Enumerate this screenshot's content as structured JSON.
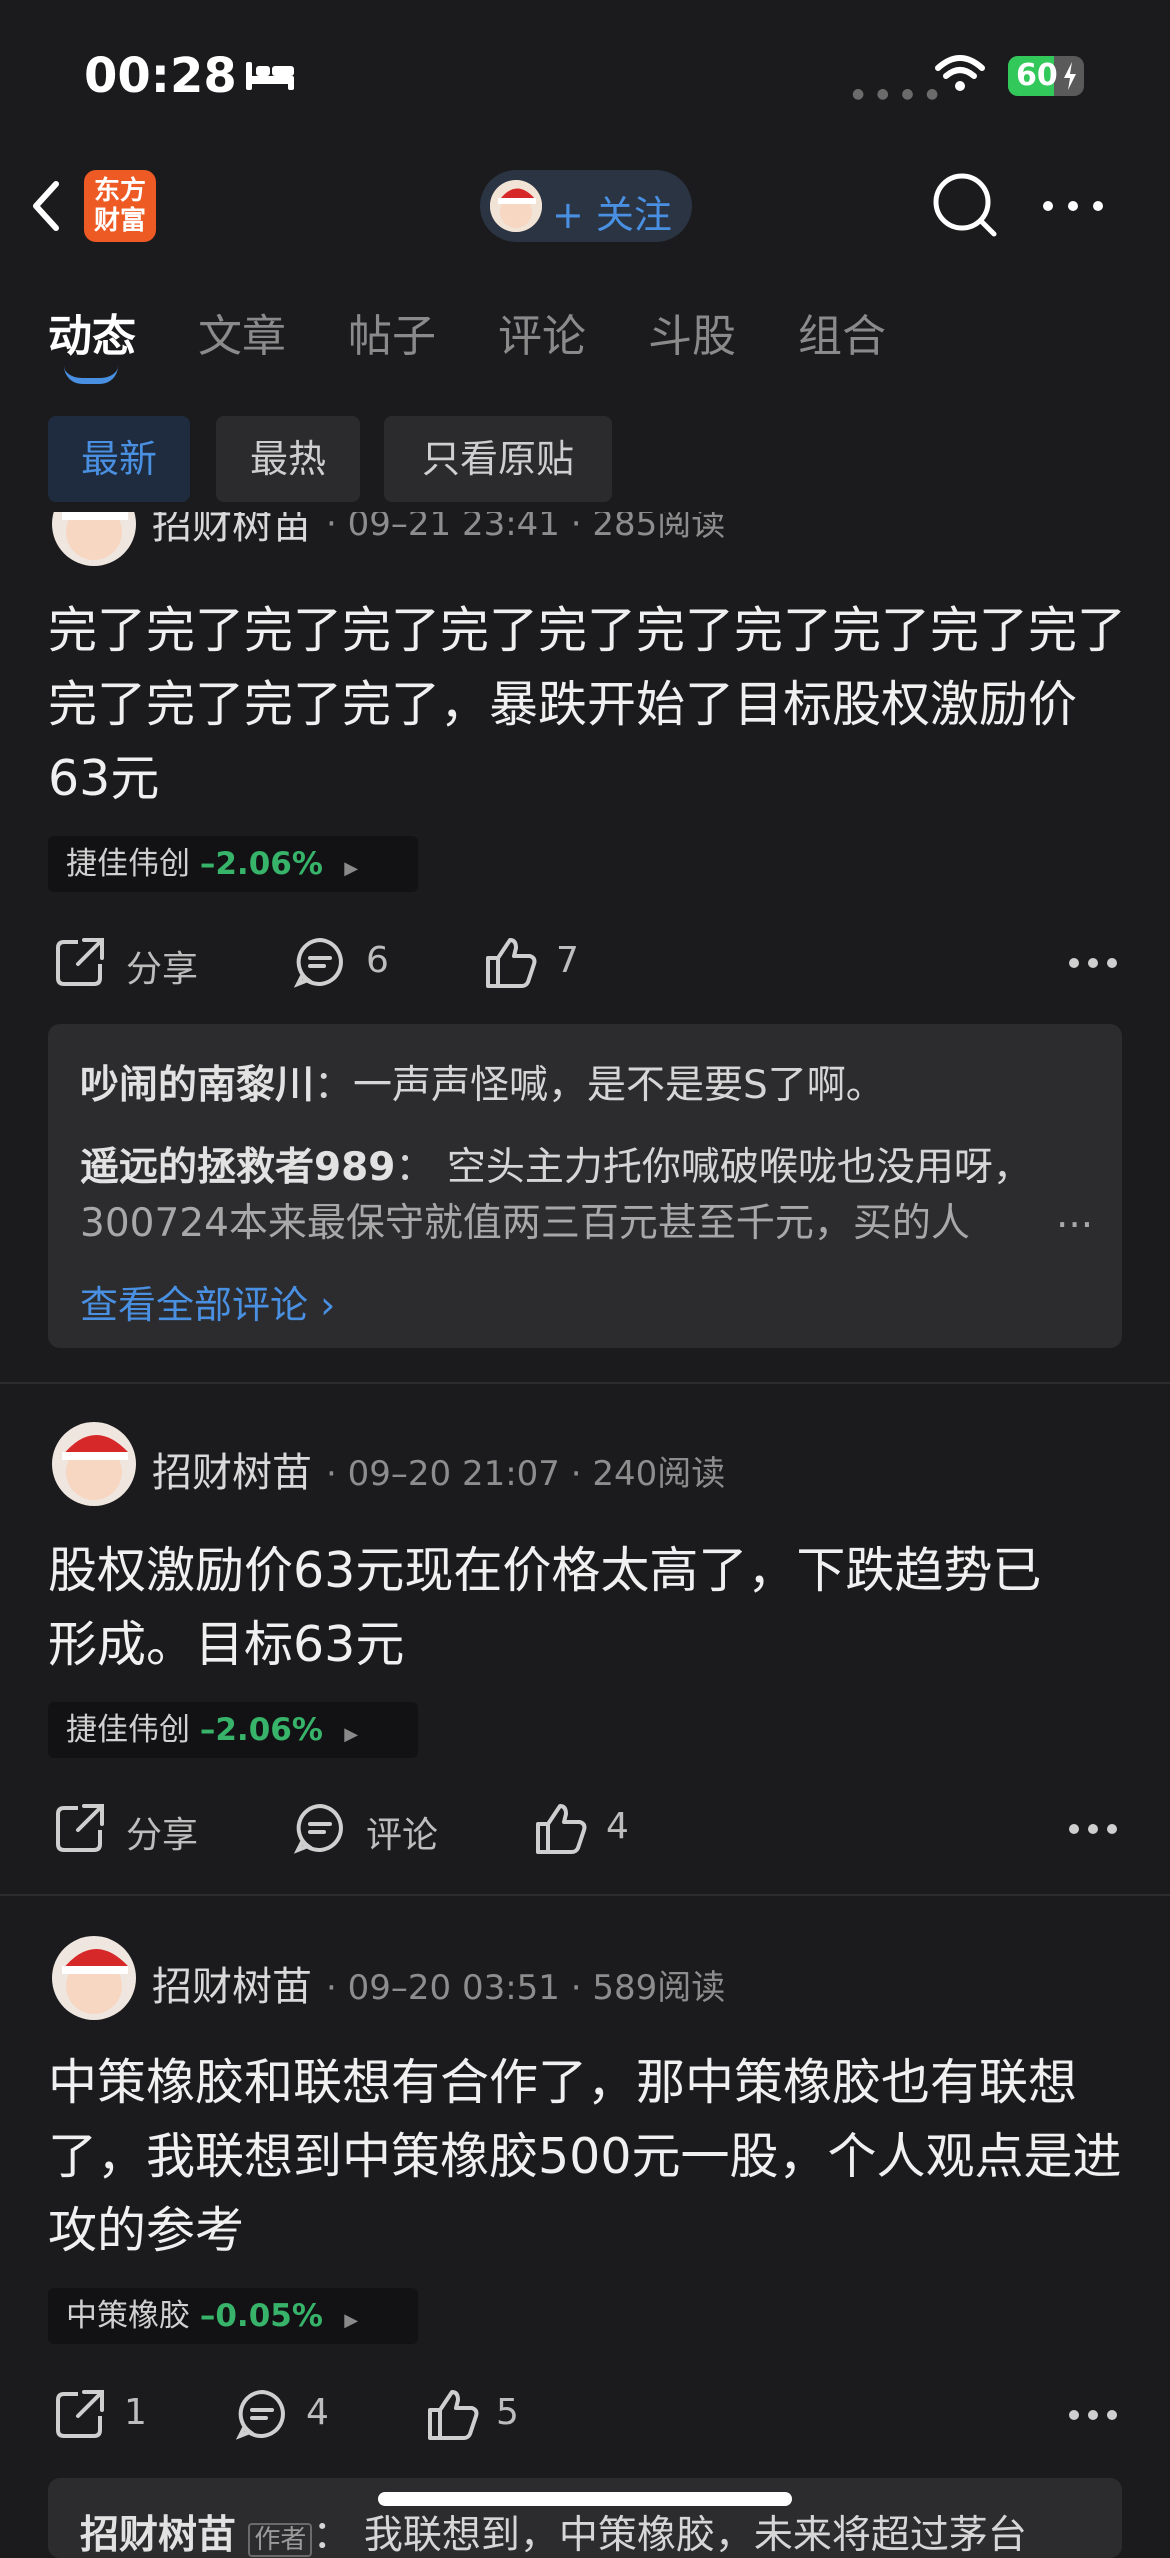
{
  "status": {
    "time": "00:28",
    "battery": "60",
    "battery_level": 0.6
  },
  "nav": {
    "logo_line1": "东方",
    "logo_line2": "财富",
    "follow_label": "+ 关注"
  },
  "tabs": [
    "动态",
    "文章",
    "帖子",
    "评论",
    "斗股",
    "组合"
  ],
  "filters": [
    "最新",
    "最热",
    "只看原贴"
  ],
  "posts": [
    {
      "author": "招财树苗",
      "meta": "· 09–21 23:41 · 285阅读",
      "text": "完了完了完了完了完了完了完了完了完了完了完了完了完了完了完了，暴跌开始了目标股权激励价63元",
      "stock_name": "捷佳伟创",
      "stock_change": "–2.06%",
      "share_label": "分享",
      "comment_count": "6",
      "like_count": "7",
      "comments": [
        {
          "name": "吵闹的南黎川",
          "text": "：一声声怪喊，是不是要S了啊。"
        },
        {
          "name": "遥远的拯救者989",
          "text": "：  空头主力托你喊破喉咙也没用呀，",
          "text2": "300724本来最保守就值两三百元甚至千元，买的人",
          "ellipsis": "..."
        }
      ],
      "view_all": "查看全部评论 ›"
    },
    {
      "author": "招财树苗",
      "meta": "· 09–20 21:07 · 240阅读",
      "text": "股权激励价63元现在价格太高了，下跌趋势已形成。目标63元",
      "stock_name": "捷佳伟创",
      "stock_change": "–2.06%",
      "share_label": "分享",
      "comment_label": "评论",
      "like_count": "4"
    },
    {
      "author": "招财树苗",
      "meta": "· 09–20 03:51 · 589阅读",
      "text": "中策橡胶和联想有合作了，那中策橡胶也有联想了，我联想到中策橡胶500元一股，个人观点是进攻的参考",
      "stock_name": "中策橡胶",
      "stock_change": "–0.05%",
      "share_count": "1",
      "comment_count": "4",
      "like_count": "5",
      "comment_preview": {
        "name": "招财树苗",
        "badge": "作者",
        "text": "：  我联想到，中策橡胶，未来将超过茅台"
      }
    }
  ]
}
